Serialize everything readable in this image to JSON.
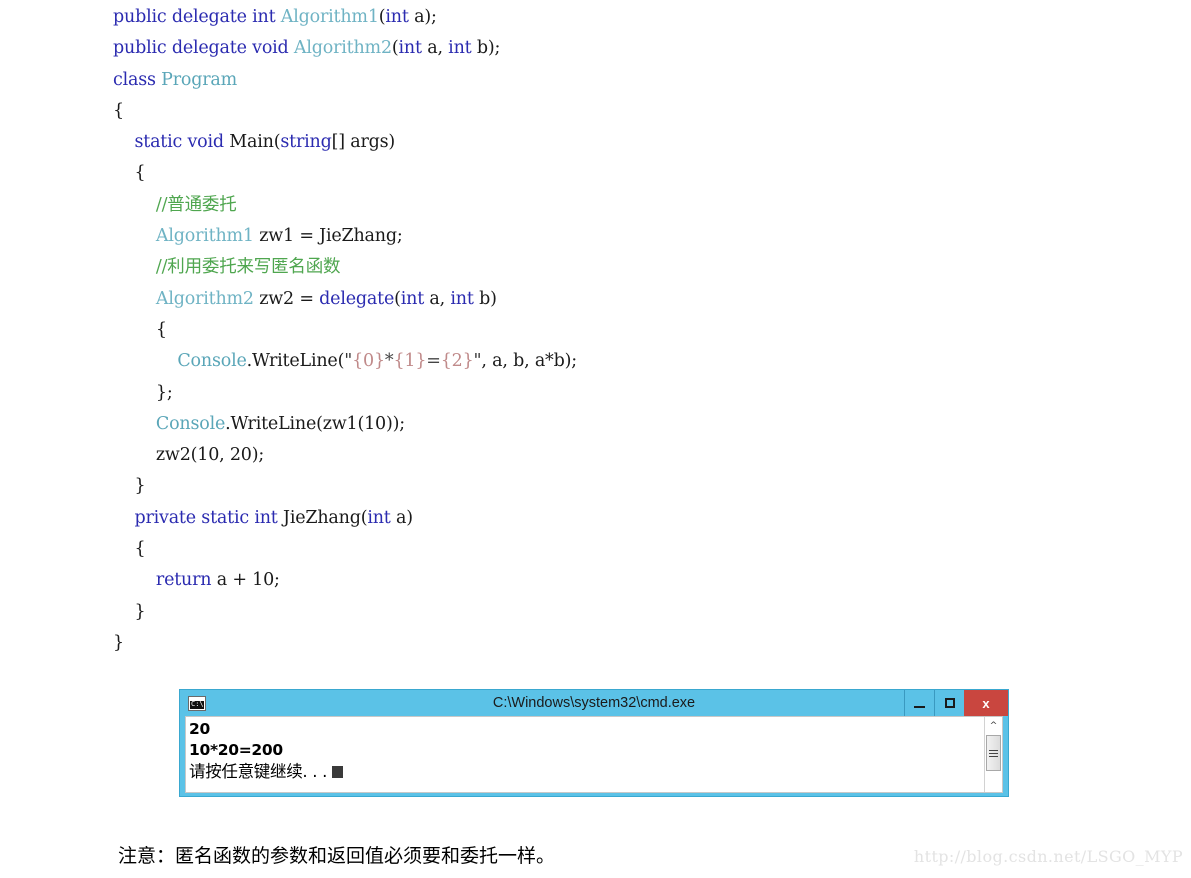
{
  "code": {
    "language": "csharp",
    "lines": [
      [
        {
          "t": "public delegate int ",
          "c": "kw"
        },
        {
          "t": "Algorithm1",
          "c": "type"
        },
        {
          "t": "(",
          "c": "plain"
        },
        {
          "t": "int",
          "c": "kw"
        },
        {
          "t": " a);",
          "c": "plain"
        }
      ],
      [
        {
          "t": "public delegate void ",
          "c": "kw"
        },
        {
          "t": "Algorithm2",
          "c": "type"
        },
        {
          "t": "(",
          "c": "plain"
        },
        {
          "t": "int",
          "c": "kw"
        },
        {
          "t": " a, ",
          "c": "plain"
        },
        {
          "t": "int",
          "c": "kw"
        },
        {
          "t": " b);",
          "c": "plain"
        }
      ],
      [
        {
          "t": "class ",
          "c": "kw"
        },
        {
          "t": "Program",
          "c": "cls"
        }
      ],
      [
        {
          "t": "{",
          "c": "plain"
        }
      ],
      [
        {
          "t": "    static void ",
          "c": "kw"
        },
        {
          "t": "Main(",
          "c": "plain"
        },
        {
          "t": "string",
          "c": "kw"
        },
        {
          "t": "[] args)",
          "c": "plain"
        }
      ],
      [
        {
          "t": "    {",
          "c": "plain"
        }
      ],
      [
        {
          "t": "        //普通委托",
          "c": "cmt"
        }
      ],
      [
        {
          "t": "        Algorithm1",
          "c": "type"
        },
        {
          "t": " zw1 = JieZhang;",
          "c": "plain"
        }
      ],
      [
        {
          "t": "        //利用委托来写匿名函数",
          "c": "cmt"
        }
      ],
      [
        {
          "t": "        Algorithm2",
          "c": "type"
        },
        {
          "t": " zw2 = ",
          "c": "plain"
        },
        {
          "t": "delegate",
          "c": "kw"
        },
        {
          "t": "(",
          "c": "plain"
        },
        {
          "t": "int",
          "c": "kw"
        },
        {
          "t": " a, ",
          "c": "plain"
        },
        {
          "t": "int",
          "c": "kw"
        },
        {
          "t": " b)",
          "c": "plain"
        }
      ],
      [
        {
          "t": "        {",
          "c": "plain"
        }
      ],
      [
        {
          "t": "            Console",
          "c": "cls"
        },
        {
          "t": ".WriteLine(",
          "c": "plain"
        },
        {
          "t": "\"",
          "c": "quote"
        },
        {
          "t": "{0}",
          "c": "brace"
        },
        {
          "t": "*",
          "c": "str"
        },
        {
          "t": "{1}",
          "c": "brace"
        },
        {
          "t": "=",
          "c": "str"
        },
        {
          "t": "{2}",
          "c": "brace"
        },
        {
          "t": "\"",
          "c": "quote"
        },
        {
          "t": ", a, b, a*b);",
          "c": "plain"
        }
      ],
      [
        {
          "t": "        };",
          "c": "plain"
        }
      ],
      [
        {
          "t": "        Console",
          "c": "cls"
        },
        {
          "t": ".WriteLine(zw1(10));",
          "c": "plain"
        }
      ],
      [
        {
          "t": "        zw2(10, 20);",
          "c": "plain"
        }
      ],
      [
        {
          "t": "    }",
          "c": "plain"
        }
      ],
      [
        {
          "t": "    private static int ",
          "c": "kw"
        },
        {
          "t": "JieZhang(",
          "c": "plain"
        },
        {
          "t": "int",
          "c": "kw"
        },
        {
          "t": " a)",
          "c": "plain"
        }
      ],
      [
        {
          "t": "    {",
          "c": "plain"
        }
      ],
      [
        {
          "t": "        return",
          "c": "kw"
        },
        {
          "t": " a + 10;",
          "c": "plain"
        }
      ],
      [
        {
          "t": "    }",
          "c": "plain"
        }
      ],
      [
        {
          "t": "}",
          "c": "plain"
        }
      ]
    ]
  },
  "cmd_window": {
    "title": "C:\\Windows\\system32\\cmd.exe",
    "icon_label": "C:\\",
    "titlebar_color": "#5bc2e7",
    "close_color": "#c9463f",
    "buttons": {
      "minimize_label": "—",
      "maximize_label": "□",
      "close_label": "x"
    },
    "console_lines": [
      "20",
      "10*20=200",
      "请按任意键继续. . ."
    ],
    "scrollbar": {
      "up_arrow": "^"
    }
  },
  "note": {
    "text": "注意：匿名函数的参数和返回值必须要和委托一样。"
  },
  "watermark": {
    "text": "http://blog.csdn.net/LSGO_MYP"
  }
}
